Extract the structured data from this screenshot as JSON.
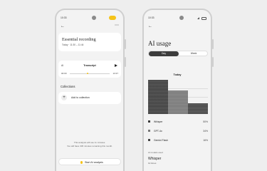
{
  "left_screen": {
    "status": {
      "time": "10:33"
    },
    "recording": {
      "title": "Essential recording",
      "date": "Today · 11:30 – 11:44"
    },
    "transcript": {
      "ai_label": "AI",
      "title": "Transcript",
      "time_start": "00:00",
      "time_end": "13:37",
      "progress": 0.45
    },
    "collections": {
      "title": "Collections",
      "add_label": "Add to collection"
    },
    "note": {
      "line1": "This analysis will use 1x minutes.",
      "line2": "You will have 345 minutes remaining this month."
    },
    "start_button": {
      "label": "Start AI analysis"
    }
  },
  "right_screen": {
    "status": {
      "time": "10:33"
    },
    "title": "AI usage",
    "tabs": [
      {
        "label": "Day",
        "active": true
      },
      {
        "label": "Week",
        "active": false
      }
    ],
    "today_label": "Today",
    "legend": [
      {
        "name": "Whisper",
        "percent": "50%",
        "color": "#3c3c3c"
      },
      {
        "name": "GPT-4o",
        "percent": "34%",
        "color": "#777777"
      },
      {
        "name": "Gemini Flash",
        "percent": "16%",
        "color": "#444444"
      }
    ],
    "most_used": {
      "label": "AI models used",
      "name": "Whisper",
      "time": "12 times"
    }
  },
  "chart_data": {
    "type": "bar",
    "categories": [
      "Whisper",
      "GPT-4o",
      "Gemini Flash"
    ],
    "values": [
      50,
      34,
      16
    ],
    "ylim": [
      0,
      50
    ],
    "title": "Today",
    "grid": true,
    "colors": [
      "#3c3c3c",
      "#777777",
      "#444444"
    ]
  }
}
